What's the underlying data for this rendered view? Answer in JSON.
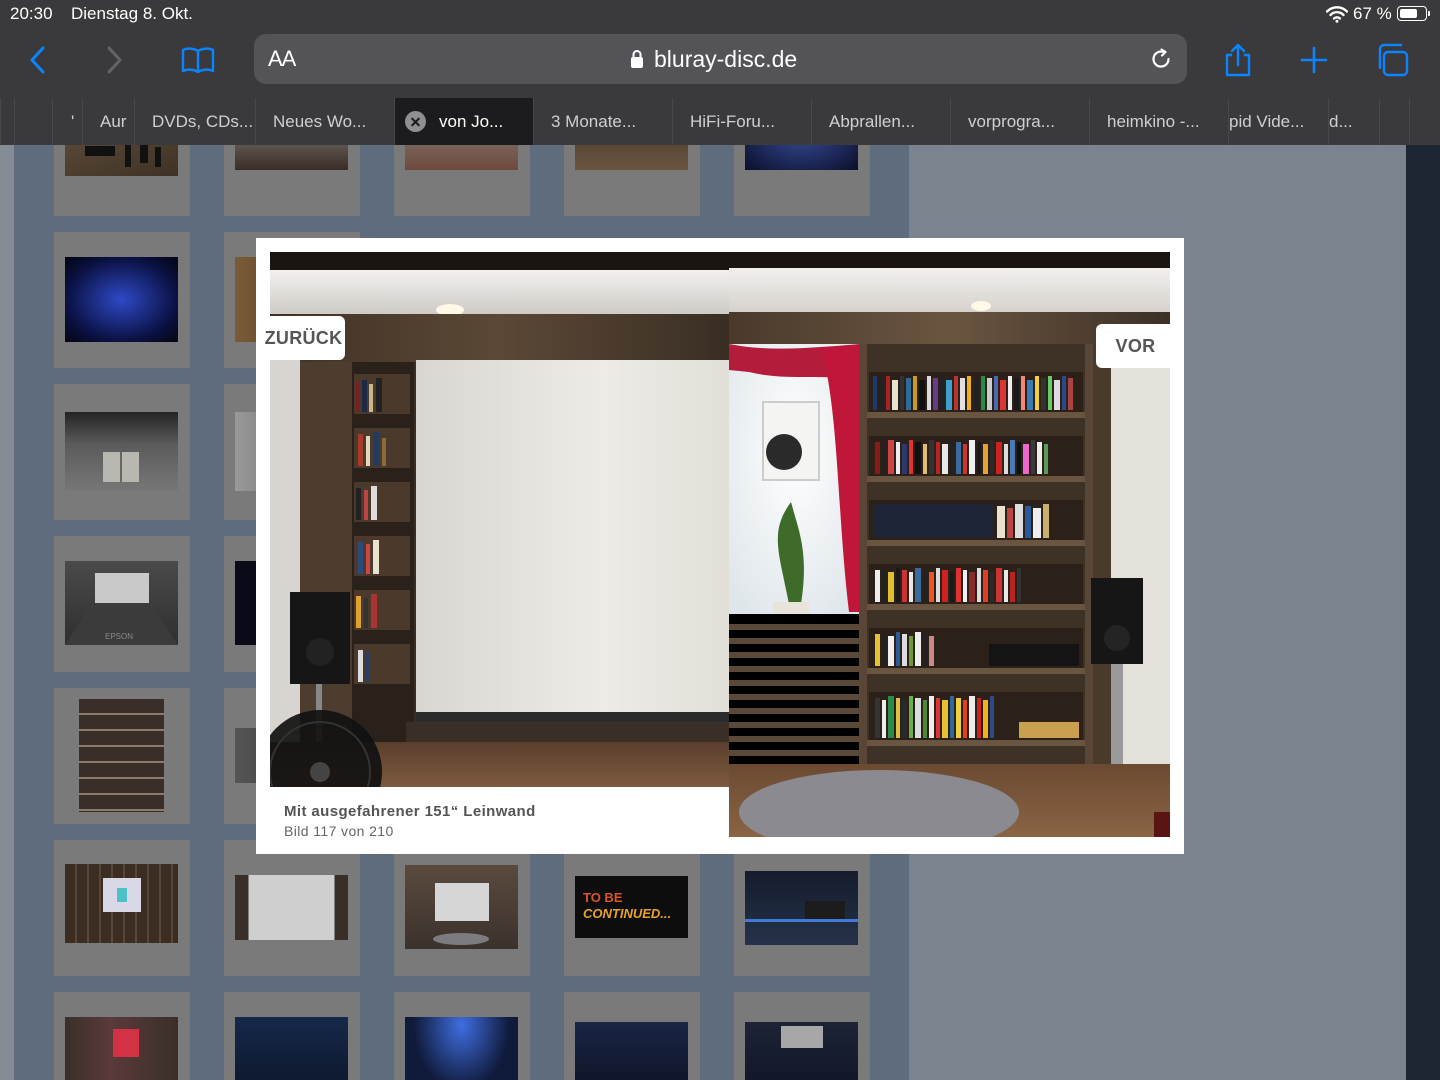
{
  "status_bar": {
    "time": "20:30",
    "date": "Dienstag 8. Okt.",
    "battery_percent": "67 %",
    "battery_level": 0.67
  },
  "toolbar": {
    "reader_label": "AA",
    "url": "bluray-disc.de"
  },
  "tabs": [
    {
      "label": "'"
    },
    {
      "label": "Aur"
    },
    {
      "label": "DVDs, CDs..."
    },
    {
      "label": "Neues Wo..."
    },
    {
      "label": "von Jo...",
      "active": true
    },
    {
      "label": "3 Monate..."
    },
    {
      "label": "HiFi-Foru..."
    },
    {
      "label": "Abprallen..."
    },
    {
      "label": "vorprogra..."
    },
    {
      "label": "heimkino -..."
    },
    {
      "label": "pid Vide..."
    },
    {
      "label": "d..."
    }
  ],
  "thumbnail_text": {
    "epson": "EPSON",
    "to_be": "TO BE",
    "continued": "CONTINUED..."
  },
  "lightbox": {
    "prev_label": "ZURÜCK",
    "next_label": "VOR",
    "caption": "Mit ausgefahrener 151“ Leinwand",
    "counter": "Bild 117 von 210"
  },
  "colors": {
    "accent": "#0a84ff",
    "chrome": "#3a3a3c",
    "tab_bar": "#2c2c2e"
  }
}
